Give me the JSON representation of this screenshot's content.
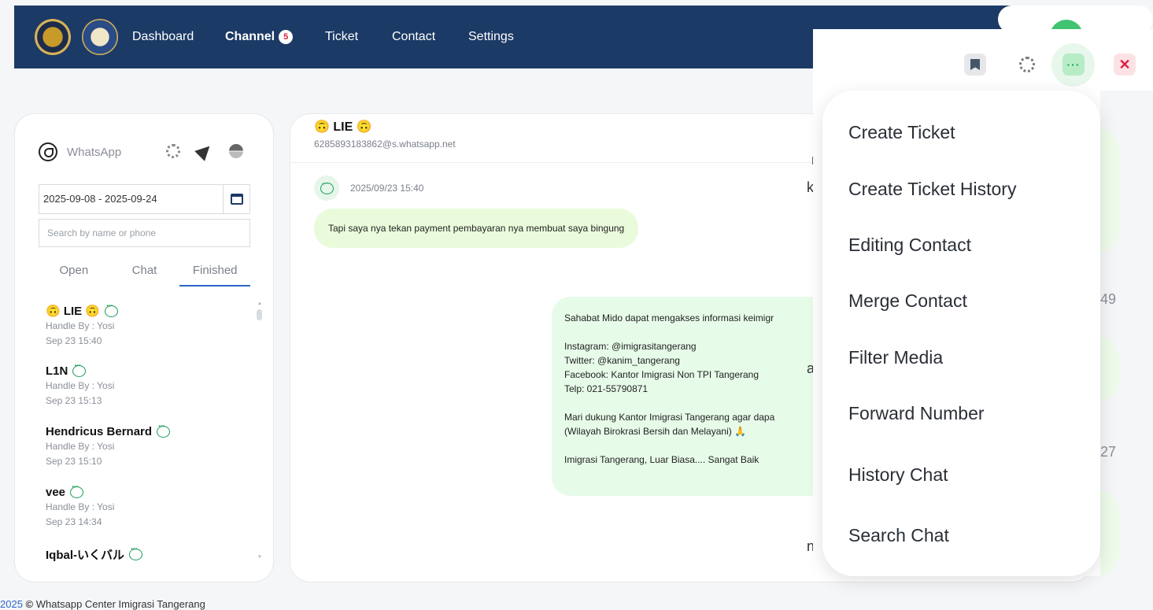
{
  "nav": {
    "items": [
      {
        "label": "Dashboard"
      },
      {
        "label": "Channel",
        "badge": "5"
      },
      {
        "label": "Ticket"
      },
      {
        "label": "Contact"
      },
      {
        "label": "Settings"
      }
    ]
  },
  "sidebar": {
    "title": "WhatsApp",
    "date_range": "2025-09-08 - 2025-09-24",
    "search_placeholder": "Search by name or phone",
    "tabs": [
      "Open",
      "Chat",
      "Finished"
    ],
    "active_tab": "Finished",
    "chats": [
      {
        "name": "🙃 LIE 🙃",
        "handler": "Handle By : Yosi",
        "time": "Sep 23 15:40"
      },
      {
        "name": "L1N",
        "handler": "Handle By : Yosi",
        "time": "Sep 23 15:13"
      },
      {
        "name": "Hendricus Bernard",
        "handler": "Handle By : Yosi",
        "time": "Sep 23 15:10"
      },
      {
        "name": "vee",
        "handler": "Handle By : Yosi",
        "time": "Sep 23 14:34"
      },
      {
        "name": "Iqbal-いくバル",
        "handler": "",
        "time": ""
      }
    ]
  },
  "conversation": {
    "contact_name": "🙃 LIE 🙃",
    "contact_phone": "6285893183862@s.whatsapp.net",
    "message_time": "2025/09/23 15:40",
    "incoming": "Tapi saya nya tekan payment pembayaran nya membuat saya bingung",
    "outgoing": "Sahabat Mido dapat mengakses informasi keimigr\n\nInstagram: @imigrasitangerang\nTwitter: @kanim_tangerang\nFacebook: Kantor Imigrasi Non TPI Tangerang\nTelp: 021-55790871\n\nMari dukung Kantor Imigrasi Tangerang agar dapa\n(Wilayah Birokrasi Bersih dan Melayani) 🙏\n\nImigrasi Tangerang, Luar Biasa.... Sangat Baik",
    "ghost_texts": [
      "m",
      "ka",
      "at",
      "ne"
    ],
    "faded_numbers": [
      "49",
      "27"
    ]
  },
  "menu": {
    "items": [
      "Create Ticket",
      "Create Ticket History",
      "Editing Contact",
      "Merge Contact",
      "Filter Media",
      "Forward Number",
      "History Chat",
      "Search Chat"
    ]
  },
  "toolbar": {
    "more_glyph": "···",
    "close_glyph": "✕"
  },
  "footer": {
    "year": "2025",
    "copyright_symbol": "©",
    "text": "Whatsapp Center Imigrasi Tangerang"
  },
  "colors": {
    "navbar": "#1c3a66",
    "accent_blue": "#2e66c8",
    "incoming_bubble": "#eafbdc",
    "outgoing_bubble": "#e7fbe9",
    "close_red": "#e11d48",
    "more_green": "#17a34a"
  }
}
